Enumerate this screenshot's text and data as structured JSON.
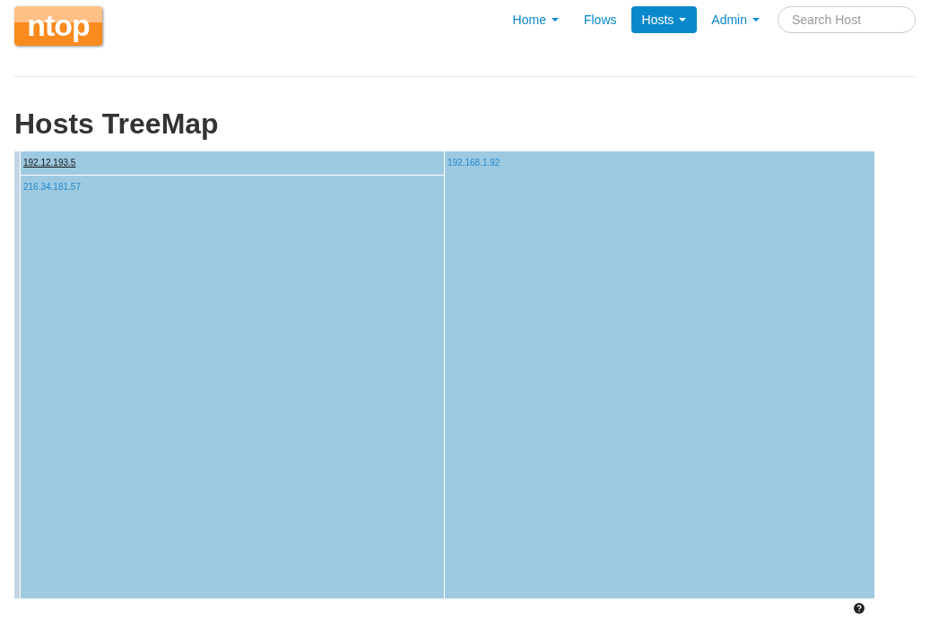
{
  "logo": "ntop",
  "nav": [
    {
      "label": "Home",
      "dropdown": true,
      "selected": false
    },
    {
      "label": "Flows",
      "dropdown": false,
      "selected": false
    },
    {
      "label": "Hosts",
      "dropdown": true,
      "selected": true
    },
    {
      "label": "Admin",
      "dropdown": true,
      "selected": false
    }
  ],
  "search": {
    "placeholder": "Search Host"
  },
  "title": "Hosts TreeMap",
  "treemap": {
    "tiles": [
      {
        "label": "192.12.193.5",
        "selected": true
      },
      {
        "label": "216.34.181.57",
        "selected": false
      },
      {
        "label": "192.168.1.92",
        "selected": false
      }
    ]
  }
}
